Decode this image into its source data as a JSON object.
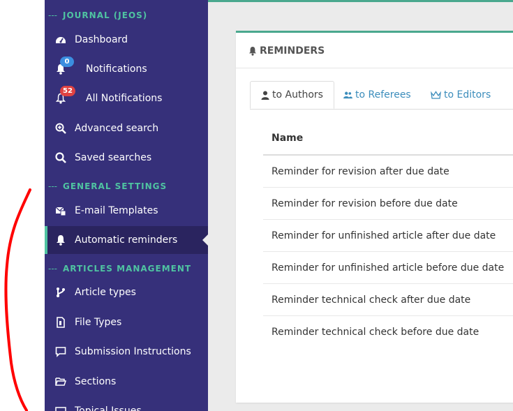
{
  "sidebar": {
    "sections": [
      {
        "title": "JOURNAL (JEOS)"
      },
      {
        "title": "GENERAL SETTINGS"
      },
      {
        "title": "ARTICLES MANAGEMENT"
      }
    ],
    "items": [
      {
        "label": "Dashboard",
        "icon": "dashboard-icon"
      },
      {
        "label": "Notifications",
        "icon": "bell-icon",
        "badge": "0"
      },
      {
        "label": "All Notifications",
        "icon": "bell-outline-icon",
        "badge": "52"
      },
      {
        "label": "Advanced search",
        "icon": "search-plus-icon"
      },
      {
        "label": "Saved searches",
        "icon": "search-icon"
      },
      {
        "label": "E-mail Templates",
        "icon": "email-template-icon"
      },
      {
        "label": "Automatic reminders",
        "icon": "bell-icon",
        "active": true
      },
      {
        "label": "Article types",
        "icon": "branch-icon"
      },
      {
        "label": "File Types",
        "icon": "file-icon"
      },
      {
        "label": "Submission Instructions",
        "icon": "comment-icon"
      },
      {
        "label": "Sections",
        "icon": "folder-open-icon"
      },
      {
        "label": "Topical Issues",
        "icon": "topical-icon"
      }
    ]
  },
  "panel": {
    "title": "REMINDERS",
    "tabs": [
      {
        "label": "to Authors",
        "icon": "user-icon",
        "active": true
      },
      {
        "label": "to Referees",
        "icon": "users-icon"
      },
      {
        "label": "to Editors",
        "icon": "crown-icon"
      }
    ],
    "table": {
      "header": "Name",
      "rows": [
        "Reminder for revision after due date",
        "Reminder for revision before due date",
        "Reminder for unfinished article after due date",
        "Reminder for unfinished article before due date",
        "Reminder technical check after due date",
        "Reminder technical check before due date"
      ]
    }
  },
  "colors": {
    "sidebar_bg": "#36307a",
    "accent": "#4fc3a1",
    "link": "#3c8dbc",
    "badge_blue": "#3b8ee0",
    "badge_red": "#e04242",
    "annotation": "#ff0000"
  }
}
